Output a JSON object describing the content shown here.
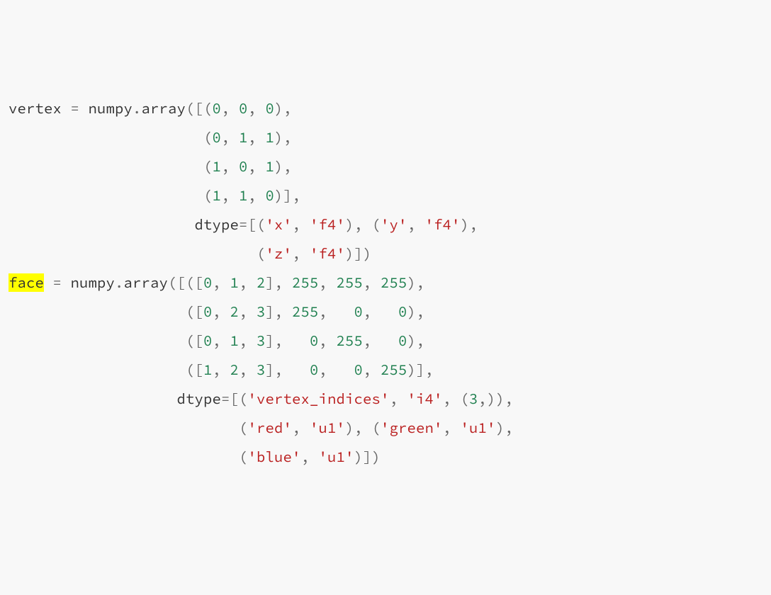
{
  "code": {
    "lines": [
      [
        {
          "t": "vertex",
          "c": "n"
        },
        {
          "t": " "
        },
        {
          "t": "=",
          "c": "op"
        },
        {
          "t": " "
        },
        {
          "t": "numpy",
          "c": "n"
        },
        {
          "t": ".",
          "c": "op"
        },
        {
          "t": "array",
          "c": "n"
        },
        {
          "t": "([(",
          "c": "op"
        },
        {
          "t": "0",
          "c": "num"
        },
        {
          "t": ",",
          "c": "op"
        },
        {
          "t": " "
        },
        {
          "t": "0",
          "c": "num"
        },
        {
          "t": ",",
          "c": "op"
        },
        {
          "t": " "
        },
        {
          "t": "0",
          "c": "num"
        },
        {
          "t": "),",
          "c": "op"
        }
      ],
      [
        {
          "t": "                      "
        },
        {
          "t": "(",
          "c": "op"
        },
        {
          "t": "0",
          "c": "num"
        },
        {
          "t": ",",
          "c": "op"
        },
        {
          "t": " "
        },
        {
          "t": "1",
          "c": "num"
        },
        {
          "t": ",",
          "c": "op"
        },
        {
          "t": " "
        },
        {
          "t": "1",
          "c": "num"
        },
        {
          "t": "),",
          "c": "op"
        }
      ],
      [
        {
          "t": "                      "
        },
        {
          "t": "(",
          "c": "op"
        },
        {
          "t": "1",
          "c": "num"
        },
        {
          "t": ",",
          "c": "op"
        },
        {
          "t": " "
        },
        {
          "t": "0",
          "c": "num"
        },
        {
          "t": ",",
          "c": "op"
        },
        {
          "t": " "
        },
        {
          "t": "1",
          "c": "num"
        },
        {
          "t": "),",
          "c": "op"
        }
      ],
      [
        {
          "t": "                      "
        },
        {
          "t": "(",
          "c": "op"
        },
        {
          "t": "1",
          "c": "num"
        },
        {
          "t": ",",
          "c": "op"
        },
        {
          "t": " "
        },
        {
          "t": "1",
          "c": "num"
        },
        {
          "t": ",",
          "c": "op"
        },
        {
          "t": " "
        },
        {
          "t": "0",
          "c": "num"
        },
        {
          "t": ")],",
          "c": "op"
        }
      ],
      [
        {
          "t": "                     "
        },
        {
          "t": "dtype",
          "c": "n"
        },
        {
          "t": "=[(",
          "c": "op"
        },
        {
          "t": "'x'",
          "c": "s"
        },
        {
          "t": ",",
          "c": "op"
        },
        {
          "t": " "
        },
        {
          "t": "'f4'",
          "c": "s"
        },
        {
          "t": "),",
          "c": "op"
        },
        {
          "t": " "
        },
        {
          "t": "(",
          "c": "op"
        },
        {
          "t": "'y'",
          "c": "s"
        },
        {
          "t": ",",
          "c": "op"
        },
        {
          "t": " "
        },
        {
          "t": "'f4'",
          "c": "s"
        },
        {
          "t": "),",
          "c": "op"
        }
      ],
      [
        {
          "t": "                            "
        },
        {
          "t": "(",
          "c": "op"
        },
        {
          "t": "'z'",
          "c": "s"
        },
        {
          "t": ",",
          "c": "op"
        },
        {
          "t": " "
        },
        {
          "t": "'f4'",
          "c": "s"
        },
        {
          "t": ")])",
          "c": "op"
        }
      ],
      [
        {
          "t": "face",
          "c": "n hl"
        },
        {
          "t": " "
        },
        {
          "t": "=",
          "c": "op"
        },
        {
          "t": " "
        },
        {
          "t": "numpy",
          "c": "n"
        },
        {
          "t": ".",
          "c": "op"
        },
        {
          "t": "array",
          "c": "n"
        },
        {
          "t": "([([",
          "c": "op"
        },
        {
          "t": "0",
          "c": "num"
        },
        {
          "t": ",",
          "c": "op"
        },
        {
          "t": " "
        },
        {
          "t": "1",
          "c": "num"
        },
        {
          "t": ",",
          "c": "op"
        },
        {
          "t": " "
        },
        {
          "t": "2",
          "c": "num"
        },
        {
          "t": "],",
          "c": "op"
        },
        {
          "t": " "
        },
        {
          "t": "255",
          "c": "num"
        },
        {
          "t": ",",
          "c": "op"
        },
        {
          "t": " "
        },
        {
          "t": "255",
          "c": "num"
        },
        {
          "t": ",",
          "c": "op"
        },
        {
          "t": " "
        },
        {
          "t": "255",
          "c": "num"
        },
        {
          "t": "),",
          "c": "op"
        }
      ],
      [
        {
          "t": "                    "
        },
        {
          "t": "([",
          "c": "op"
        },
        {
          "t": "0",
          "c": "num"
        },
        {
          "t": ",",
          "c": "op"
        },
        {
          "t": " "
        },
        {
          "t": "2",
          "c": "num"
        },
        {
          "t": ",",
          "c": "op"
        },
        {
          "t": " "
        },
        {
          "t": "3",
          "c": "num"
        },
        {
          "t": "],",
          "c": "op"
        },
        {
          "t": " "
        },
        {
          "t": "255",
          "c": "num"
        },
        {
          "t": ",",
          "c": "op"
        },
        {
          "t": "   "
        },
        {
          "t": "0",
          "c": "num"
        },
        {
          "t": ",",
          "c": "op"
        },
        {
          "t": "   "
        },
        {
          "t": "0",
          "c": "num"
        },
        {
          "t": "),",
          "c": "op"
        }
      ],
      [
        {
          "t": "                    "
        },
        {
          "t": "([",
          "c": "op"
        },
        {
          "t": "0",
          "c": "num"
        },
        {
          "t": ",",
          "c": "op"
        },
        {
          "t": " "
        },
        {
          "t": "1",
          "c": "num"
        },
        {
          "t": ",",
          "c": "op"
        },
        {
          "t": " "
        },
        {
          "t": "3",
          "c": "num"
        },
        {
          "t": "],",
          "c": "op"
        },
        {
          "t": "   "
        },
        {
          "t": "0",
          "c": "num"
        },
        {
          "t": ",",
          "c": "op"
        },
        {
          "t": " "
        },
        {
          "t": "255",
          "c": "num"
        },
        {
          "t": ",",
          "c": "op"
        },
        {
          "t": "   "
        },
        {
          "t": "0",
          "c": "num"
        },
        {
          "t": "),",
          "c": "op"
        }
      ],
      [
        {
          "t": "                    "
        },
        {
          "t": "([",
          "c": "op"
        },
        {
          "t": "1",
          "c": "num"
        },
        {
          "t": ",",
          "c": "op"
        },
        {
          "t": " "
        },
        {
          "t": "2",
          "c": "num"
        },
        {
          "t": ",",
          "c": "op"
        },
        {
          "t": " "
        },
        {
          "t": "3",
          "c": "num"
        },
        {
          "t": "],",
          "c": "op"
        },
        {
          "t": "   "
        },
        {
          "t": "0",
          "c": "num"
        },
        {
          "t": ",",
          "c": "op"
        },
        {
          "t": "   "
        },
        {
          "t": "0",
          "c": "num"
        },
        {
          "t": ",",
          "c": "op"
        },
        {
          "t": " "
        },
        {
          "t": "255",
          "c": "num"
        },
        {
          "t": ")],",
          "c": "op"
        }
      ],
      [
        {
          "t": "                   "
        },
        {
          "t": "dtype",
          "c": "n"
        },
        {
          "t": "=[(",
          "c": "op"
        },
        {
          "t": "'vertex_indices'",
          "c": "s"
        },
        {
          "t": ",",
          "c": "op"
        },
        {
          "t": " "
        },
        {
          "t": "'i4'",
          "c": "s"
        },
        {
          "t": ",",
          "c": "op"
        },
        {
          "t": " "
        },
        {
          "t": "(",
          "c": "op"
        },
        {
          "t": "3",
          "c": "num"
        },
        {
          "t": ",)),",
          "c": "op"
        }
      ],
      [
        {
          "t": "                          "
        },
        {
          "t": "(",
          "c": "op"
        },
        {
          "t": "'red'",
          "c": "s"
        },
        {
          "t": ",",
          "c": "op"
        },
        {
          "t": " "
        },
        {
          "t": "'u1'",
          "c": "s"
        },
        {
          "t": "),",
          "c": "op"
        },
        {
          "t": " "
        },
        {
          "t": "(",
          "c": "op"
        },
        {
          "t": "'green'",
          "c": "s"
        },
        {
          "t": ",",
          "c": "op"
        },
        {
          "t": " "
        },
        {
          "t": "'u1'",
          "c": "s"
        },
        {
          "t": "),",
          "c": "op"
        }
      ],
      [
        {
          "t": "                          "
        },
        {
          "t": "(",
          "c": "op"
        },
        {
          "t": "'blue'",
          "c": "s"
        },
        {
          "t": ",",
          "c": "op"
        },
        {
          "t": " "
        },
        {
          "t": "'u1'",
          "c": "s"
        },
        {
          "t": ")])",
          "c": "op"
        }
      ]
    ]
  }
}
